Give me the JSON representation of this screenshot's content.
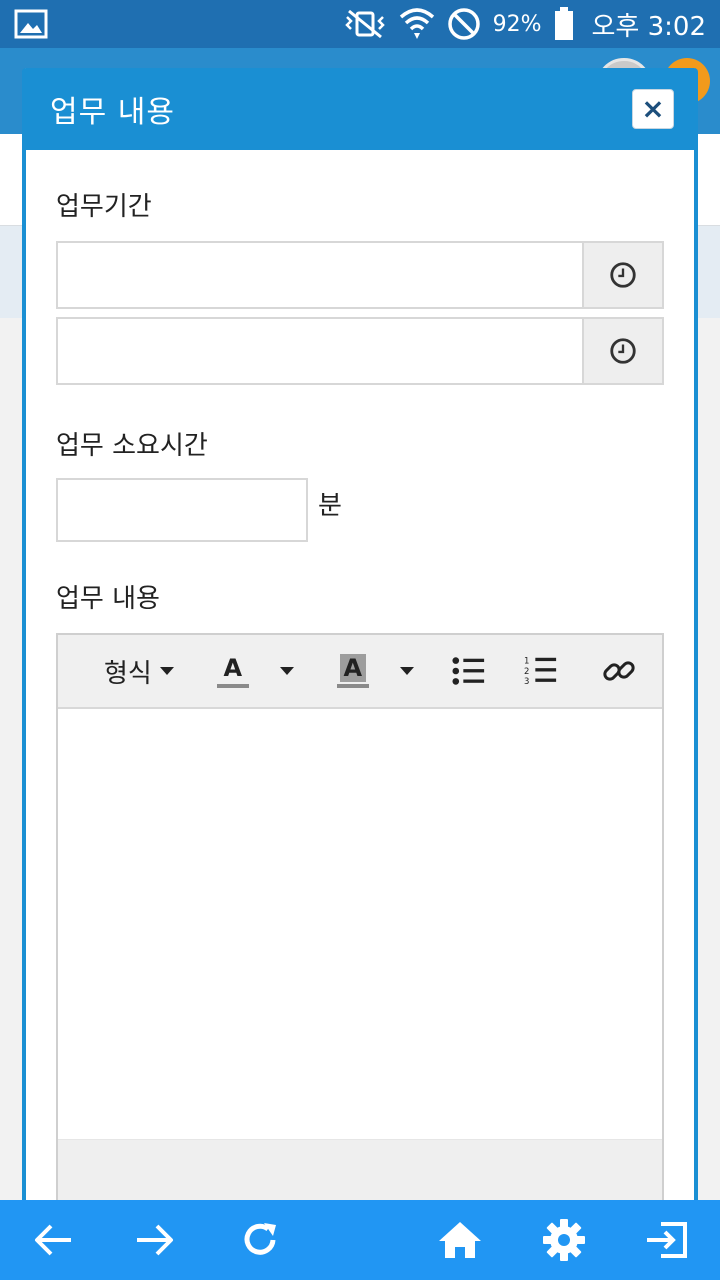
{
  "status_bar": {
    "battery_percent": "92%",
    "time": "오후 3:02"
  },
  "modal": {
    "title": "업무 내용",
    "close_label": "×",
    "period_label": "업무기간",
    "start_placeholder": "",
    "end_placeholder": "",
    "duration_label": "업무 소요시간",
    "duration_value": "",
    "duration_unit": "분",
    "content_label": "업무 내용",
    "toolbar": {
      "format_label": "형식",
      "font_color_letter": "A",
      "bg_color_letter": "A"
    }
  },
  "colors": {
    "status_bar": "#1f6fb1",
    "header": "#1a8fd3",
    "bottom_nav": "#2196f3"
  },
  "icons": [
    "gallery-icon",
    "vibrate-mute-icon",
    "wifi-icon",
    "no-sync-icon",
    "battery-icon",
    "clock-icon",
    "bullet-list-icon",
    "numbered-list-icon",
    "link-icon",
    "back-arrow-icon",
    "forward-arrow-icon",
    "refresh-icon",
    "home-icon",
    "settings-icon",
    "exit-icon"
  ]
}
